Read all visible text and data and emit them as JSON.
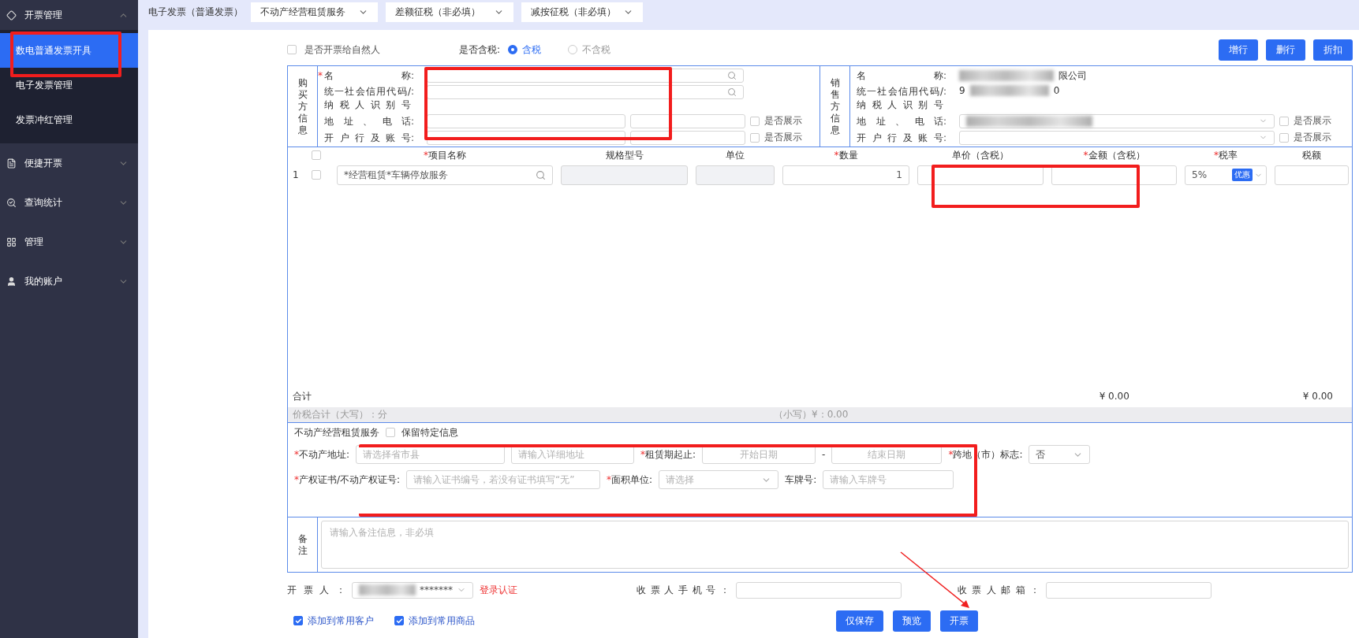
{
  "sidebar": {
    "menus": [
      {
        "label": "开票管理",
        "expanded": true,
        "children": [
          {
            "label": "数电普通发票开具",
            "selected": true,
            "highlighted": true
          },
          {
            "label": "电子发票管理",
            "selected": false,
            "highlighted": false
          },
          {
            "label": "发票冲红管理",
            "selected": false,
            "highlighted": false
          }
        ]
      },
      {
        "label": "便捷开票",
        "expanded": false
      },
      {
        "label": "查询统计",
        "expanded": false
      },
      {
        "label": "管理",
        "expanded": false
      },
      {
        "label": "我的账户",
        "expanded": false
      }
    ]
  },
  "top_bar": {
    "title": "电子发票（普通发票）",
    "selects": [
      {
        "value": "不动产经营租赁服务"
      },
      {
        "value": "差额征税（非必填）"
      },
      {
        "value": "减按征税（非必填）"
      }
    ]
  },
  "options": {
    "natural_person": {
      "label": "是否开票给自然人",
      "checked": false
    },
    "tax_label": "是否含税:",
    "tax_choices": [
      {
        "label": "含税",
        "selected": true
      },
      {
        "label": "不含税",
        "selected": false
      }
    ]
  },
  "row_buttons": [
    "增行",
    "删行",
    "折扣"
  ],
  "buyer": {
    "section_label": "购买方信息",
    "highlighted": true,
    "mark": "*",
    "name_label": "名称",
    "id_label_1": "统一社会信用代码/",
    "id_label_2": "纳税人识别号",
    "address_label": "地址、电话",
    "bank_label": "开户行及账号",
    "name_colon": ":",
    "id_colon": ":",
    "address_colon": ":",
    "bank_colon": ":",
    "address_show_label": "是否展示",
    "bank_show_label": "是否展示",
    "address_show": false,
    "bank_show": false
  },
  "seller": {
    "section_label": "销售方信息",
    "name_label": "名称",
    "name_tail": "限公司",
    "id_label_1": "统一社会信用代码/",
    "id_label_2": "纳税人识别号",
    "id_head": "9",
    "id_tail": "0",
    "address_label": "地址、电话",
    "bank_label": "开户行及账号",
    "name_colon": ":",
    "id_colon": ":",
    "address_colon": ":",
    "bank_colon": ":",
    "address_show_label": "是否展示",
    "bank_show_label": "是否展示",
    "address_show": false,
    "bank_show": false
  },
  "lines": {
    "price_highlighted": true,
    "header_checked": false,
    "columns": [
      {
        "label": "项目名称",
        "mark": "*"
      },
      {
        "label": "规格型号"
      },
      {
        "label": "单位"
      },
      {
        "label": "数量",
        "mark": "*"
      },
      {
        "label": "单价（含税）"
      },
      {
        "label": "金额（含税）",
        "mark": "*"
      },
      {
        "label": "税率",
        "mark": "*"
      },
      {
        "label": "税额"
      }
    ],
    "rows": [
      {
        "index": "1",
        "checked": false,
        "item": "*经营租赁*车辆停放服务",
        "quantity": "1",
        "rate": "5%",
        "badge": "优惠"
      }
    ],
    "total_label": "合计",
    "total_amount": "¥ 0.00",
    "total_tax": "¥ 0.00"
  },
  "sum": {
    "upper": "价税合计（大写）：分",
    "lower": "（小写）¥：0.00"
  },
  "property": {
    "highlighted": true,
    "title": "不动产经营租赁服务",
    "keep": {
      "label": "保留特定信息",
      "checked": false
    },
    "address_label": "不动产地址:",
    "address_mark": "*",
    "region_placeholder": "请选择省市县",
    "detail_placeholder": "请输入详细地址",
    "period_label": "租赁期起止:",
    "period_mark": "*",
    "start_placeholder": "开始日期",
    "dash": "-",
    "end_placeholder": "结束日期",
    "cross_label": "跨地（市）标志:",
    "cross_mark": "*",
    "cross_value": "否",
    "cert_label": "产权证书/不动产权证号:",
    "cert_mark": "*",
    "cert_placeholder": "请输入证书编号，若没有证书填写“无”",
    "area_label": "面积单位:",
    "area_mark": "*",
    "area_placeholder": "请选择",
    "plate_label": "车牌号:",
    "plate_placeholder": "请输入车牌号"
  },
  "remarks": {
    "label": "备注",
    "placeholder": "请输入备注信息，非必填"
  },
  "footer": {
    "issuer_label": "开票人：",
    "issuer_value": "*******",
    "login_link": "登录认证",
    "phone_label": "收票人手机号：",
    "email_label": "收票人邮箱：",
    "checks": [
      {
        "label": "添加到常用客户",
        "checked": true
      },
      {
        "label": "添加到常用商品",
        "checked": true
      }
    ],
    "buttons": [
      {
        "label": "仅保存"
      },
      {
        "label": "预览"
      },
      {
        "label": "开票"
      }
    ],
    "pointer_arrow": true
  }
}
